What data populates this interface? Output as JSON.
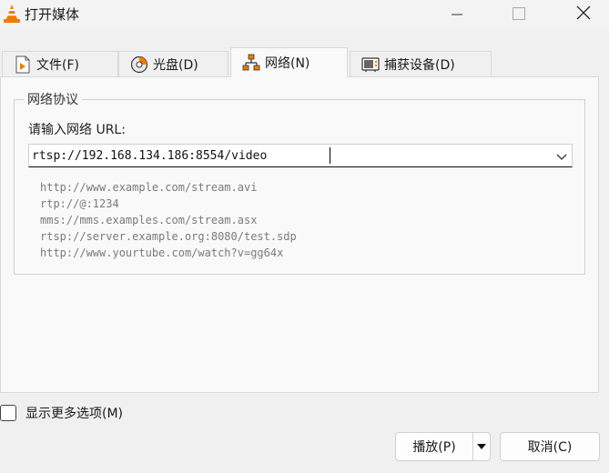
{
  "window": {
    "title": "打开媒体",
    "app_icon": "vlc-cone-icon",
    "controls": [
      "minimize-icon",
      "maximize-icon",
      "close-icon"
    ]
  },
  "tabs": [
    {
      "label": "文件(F)",
      "icon": "file-play-icon",
      "active": false
    },
    {
      "label": "光盘(D)",
      "icon": "disc-icon",
      "active": false
    },
    {
      "label": "网络(N)",
      "icon": "network-icon",
      "active": true
    },
    {
      "label": "捕获设备(D)",
      "icon": "capture-device-icon",
      "active": false
    }
  ],
  "network": {
    "group_title": "网络协议",
    "url_label": "请输入网络 URL:",
    "url_value": "rtsp://192.168.134.186:8554/video",
    "examples": [
      "http://www.example.com/stream.avi",
      "rtp://@:1234",
      "mms://mms.examples.com/stream.asx",
      "rtsp://server.example.org:8080/test.sdp",
      "http://www.yourtube.com/watch?v=gg64x"
    ]
  },
  "footer": {
    "more_options_label": "显示更多选项(M)",
    "more_options_checked": false,
    "play_label": "播放(P)",
    "cancel_label": "取消(C)"
  },
  "colors": {
    "vlc_orange": "#f07b00",
    "window_bg": "#f0f0f0",
    "panel_bg": "#f9f9f9"
  }
}
